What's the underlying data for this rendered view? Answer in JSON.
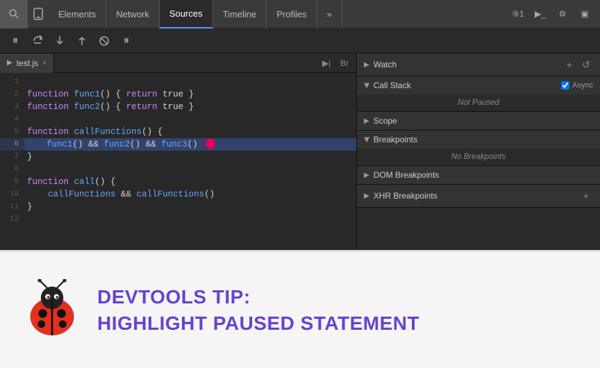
{
  "toolbar": {
    "tabs": [
      {
        "id": "elements",
        "label": "Elements",
        "active": false
      },
      {
        "id": "network",
        "label": "Network",
        "active": false
      },
      {
        "id": "sources",
        "label": "Sources",
        "active": true
      },
      {
        "id": "timeline",
        "label": "Timeline",
        "active": false
      },
      {
        "id": "profiles",
        "label": "Profiles",
        "active": false
      }
    ],
    "more_label": "»",
    "counter": "⑨1",
    "terminal_label": "▶_",
    "settings_label": "⚙",
    "monitor_label": "▣"
  },
  "debug_toolbar": {
    "pause_label": "⏸",
    "step_over_label": "↺",
    "step_into_label": "↓",
    "step_out_label": "↑",
    "deactivate_label": "⊘",
    "pause_exceptions_label": "⏸"
  },
  "file_tab": {
    "play_icon": "▶",
    "name": "test.js",
    "close": "×",
    "action1": "▶|",
    "action2": "Br"
  },
  "code": {
    "lines": [
      {
        "num": 1,
        "text": ""
      },
      {
        "num": 2,
        "text": "function func1() { return true }"
      },
      {
        "num": 3,
        "text": "function func2() { return true }"
      },
      {
        "num": 4,
        "text": ""
      },
      {
        "num": 5,
        "text": "function callFunctions() {"
      },
      {
        "num": 6,
        "text": "    func1() && func2() && func3()",
        "highlight": true,
        "hasBreakpoint": true
      },
      {
        "num": 7,
        "text": "}"
      },
      {
        "num": 8,
        "text": ""
      },
      {
        "num": 9,
        "text": "function call() {"
      },
      {
        "num": 10,
        "text": "    callFunctions && callFunctions()"
      },
      {
        "num": 11,
        "text": "}"
      },
      {
        "num": 12,
        "text": ""
      }
    ]
  },
  "right_panel": {
    "sections": [
      {
        "id": "watch",
        "title": "Watch",
        "collapsed": false,
        "actions": [
          "+",
          "↺"
        ],
        "content": null
      },
      {
        "id": "call-stack",
        "title": "Call Stack",
        "collapsed": false,
        "async_label": "Async",
        "async_checked": true,
        "content": "Not Paused"
      },
      {
        "id": "scope",
        "title": "Scope",
        "collapsed": false,
        "content": null
      },
      {
        "id": "breakpoints",
        "title": "Breakpoints",
        "collapsed": false,
        "content": "No Breakpoints"
      },
      {
        "id": "dom-breakpoints",
        "title": "DOM Breakpoints",
        "collapsed": false,
        "content": null
      },
      {
        "id": "xhr-breakpoints",
        "title": "XHR Breakpoints",
        "collapsed": false,
        "actions": [
          "+"
        ],
        "content": null
      }
    ]
  },
  "tip": {
    "title_line1": "DevTools Tip:",
    "title_line2": "Highlight Paused Statement"
  }
}
